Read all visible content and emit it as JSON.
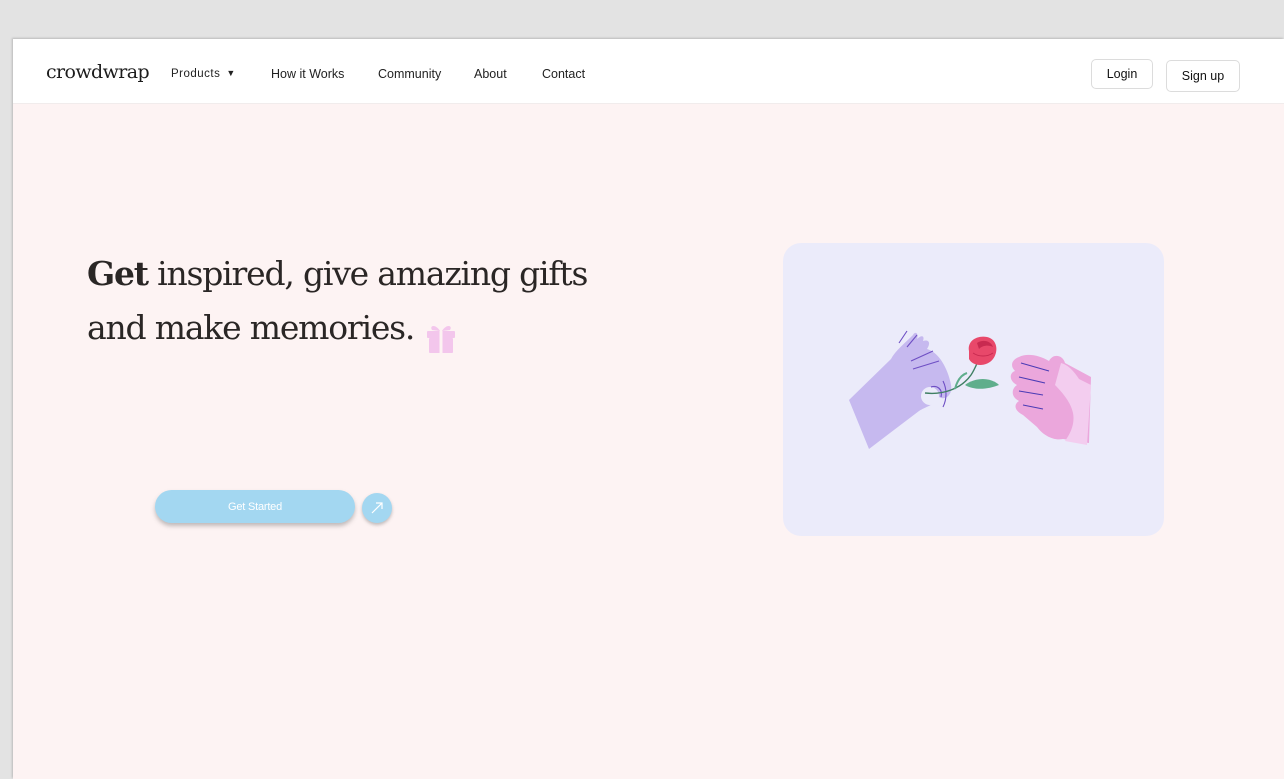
{
  "brand": {
    "logo_text": "crowdwrap"
  },
  "nav": {
    "products_label": "Products",
    "products_caret": "▼",
    "how_it_works_label": "How it Works",
    "community_label": "Community",
    "about_label": "About",
    "contact_label": "Contact"
  },
  "auth": {
    "login_label": "Login",
    "signup_label": "Sign up"
  },
  "hero": {
    "title_strong": "Get",
    "title_rest_line1": " inspired, give amazing gifts",
    "title_line2": "and make memories.",
    "cta_label": "Get Started"
  },
  "icons": {
    "gift": "gift-icon",
    "arrow": "arrow-up-right-icon",
    "illustration": "hands-giving-rose-illustration"
  },
  "colors": {
    "page_bg": "#fdf3f3",
    "cta": "#a3d7f1",
    "card_bg": "#ebebfa",
    "gift": "#f3c6ec",
    "hand_left": "#c6b9ef",
    "hand_right": "#eba7dc",
    "rose": "#e8486a",
    "leaf": "#5fae8c"
  }
}
